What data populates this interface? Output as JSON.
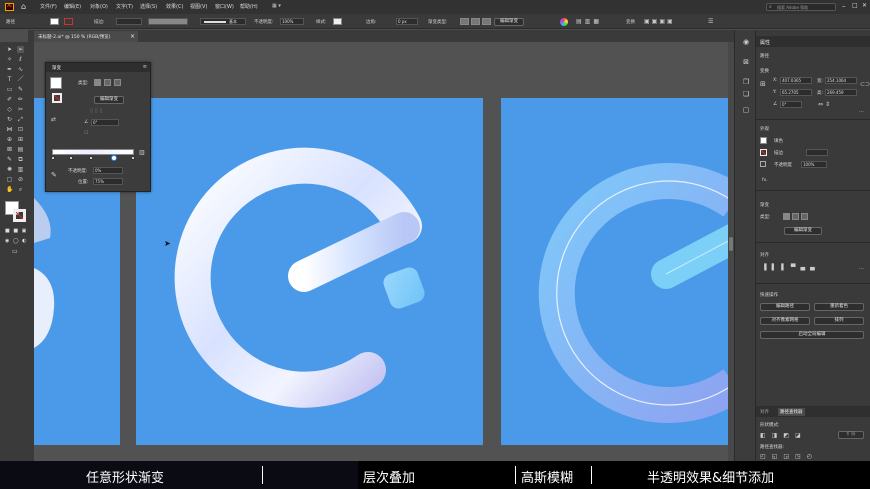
{
  "app": {
    "logo": "Ai"
  },
  "menu": [
    "文件(F)",
    "编辑(E)",
    "对象(O)",
    "文字(T)",
    "选择(S)",
    "效果(C)",
    "视图(V)",
    "窗口(W)",
    "帮助(H)"
  ],
  "search_placeholder": "搜索 Adobe 帮助",
  "control": {
    "path_label": "路径",
    "stroke_label": "描边:",
    "stroke_style": "基本",
    "opacity_label": "不透明度:",
    "opacity_value": "100%",
    "style_label": "样式:",
    "corner_label": "边角:",
    "corner_value": "0 px",
    "gradient_type_label": "渐变类型:",
    "edit_gradient": "编辑渐变",
    "transform": "变换",
    "align_label": "对齐"
  },
  "document_tab": {
    "title": "未标题-2.ai* @ 150 % (RGB/预览)",
    "close": "×"
  },
  "gradient_panel": {
    "title": "渐变",
    "type_label": "类型:",
    "edit_button": "编辑渐变",
    "angle_value": "0°",
    "opacity_label": "不透明度:",
    "opacity_value": "0%",
    "position_label": "位置:",
    "position_value": "75%"
  },
  "properties": {
    "tab_title": "属性",
    "path_label": "路径",
    "transform_label": "变换",
    "x_label": "X:",
    "x_value": "407.0365",
    "y_label": "Y:",
    "y_value": "65.2705",
    "w_label": "宽:",
    "w_value": "254.1064",
    "h_label": "高:",
    "h_value": "269.459",
    "angle_value": "0°",
    "appearance_label": "外观",
    "fill_label": "填色",
    "stroke_label": "描边",
    "opacity_label": "不透明度",
    "opacity_value": "100%",
    "fx": "fx.",
    "gradient_label": "渐变",
    "gradient_type_label": "类型:",
    "edit_gradient": "编辑渐变",
    "align_label": "对齐",
    "quick_actions_label": "快速操作",
    "edit_path": "编辑路径",
    "recolor": "重新着色",
    "distort_mesh": "对齐像素网格",
    "arrange": "排列",
    "global_edit": "启动全局编辑",
    "bottom_tab_1": "对齐",
    "bottom_tab_2": "路径查找器",
    "shape_modes_label": "形状模式:",
    "expand": "扩展",
    "pathfinders_label": "路径查找器:"
  },
  "caption": {
    "part1": "任意形状渐变",
    "part2": "层次叠加",
    "part3": "高斯模糊",
    "part4": "半透明效果&细节添加"
  },
  "colors": {
    "artboard": "#4b9ae9",
    "caption_bg": "#0b0b14",
    "panel": "#3a3a3a"
  }
}
